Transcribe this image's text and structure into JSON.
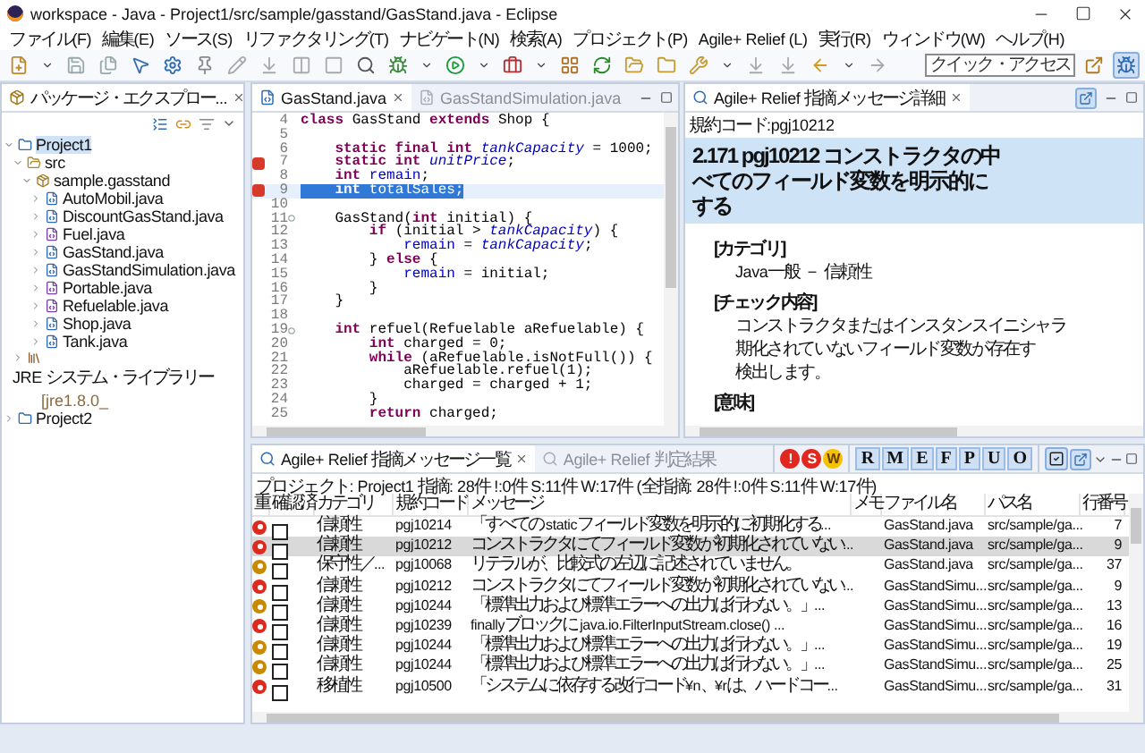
{
  "window": {
    "title": "workspace - Java - Project1/src/sample/gasstand/GasStand.java - Eclipse"
  },
  "menu": [
    "ファイル(F)",
    "編集(E)",
    "ソース(S)",
    "リファクタリング(T)",
    "ナビゲート(N)",
    "検索(A)",
    "プロジェクト(P)",
    "Agile+ Relief (L)",
    "実行(R)",
    "ウィンドウ(W)",
    "ヘルプ(H)"
  ],
  "quick_access": {
    "placeholder": "クイック・アクセス"
  },
  "package_explorer": {
    "tab": "パッケージ・エクスプロー...",
    "tree": [
      {
        "label": "Project1",
        "kind": "project",
        "expanded": true,
        "selected": true,
        "children": [
          {
            "label": "src",
            "kind": "folder",
            "expanded": true,
            "selected": false,
            "children": [
              {
                "label": "sample.gasstand",
                "kind": "package",
                "expanded": true,
                "selected": false,
                "children": [
                  {
                    "label": "AutoMobil.java",
                    "kind": "class",
                    "expanded": false,
                    "selected": false
                  },
                  {
                    "label": "DiscountGasStand.java",
                    "kind": "class",
                    "expanded": false,
                    "selected": false
                  },
                  {
                    "label": "Fuel.java",
                    "kind": "interface",
                    "expanded": false,
                    "selected": false
                  },
                  {
                    "label": "GasStand.java",
                    "kind": "class",
                    "expanded": false,
                    "selected": false
                  },
                  {
                    "label": "GasStandSimulation.java",
                    "kind": "class",
                    "expanded": false,
                    "selected": false
                  },
                  {
                    "label": "Portable.java",
                    "kind": "interface",
                    "expanded": false,
                    "selected": false
                  },
                  {
                    "label": "Refuelable.java",
                    "kind": "interface",
                    "expanded": false,
                    "selected": false
                  },
                  {
                    "label": "Shop.java",
                    "kind": "class",
                    "expanded": false,
                    "selected": false
                  },
                  {
                    "label": "Tank.java",
                    "kind": "class",
                    "expanded": false,
                    "selected": false
                  }
                ]
              }
            ]
          },
          {
            "label": "JRE システム・ライブラリー",
            "decoration": "[jre1.8.0_",
            "kind": "library",
            "expanded": false,
            "selected": false
          }
        ]
      },
      {
        "label": "Project2",
        "kind": "project",
        "expanded": false,
        "selected": false
      }
    ]
  },
  "editor": {
    "tabs": [
      {
        "label": "GasStand.java",
        "selected": true
      },
      {
        "label": "GasStandSimulation.java",
        "selected": false
      }
    ],
    "lines": [
      {
        "number": "4",
        "error": false,
        "fold": false,
        "selected": false,
        "tokens": [
          {
            "kind": "kw",
            "text": "class"
          },
          {
            "kind": "plain",
            "text": " GasStand "
          },
          {
            "kind": "kw",
            "text": "extends"
          },
          {
            "kind": "plain",
            "text": " Shop {"
          }
        ]
      },
      {
        "number": "5",
        "error": false,
        "fold": false,
        "selected": false
      },
      {
        "number": "6",
        "error": false,
        "fold": false,
        "selected": false,
        "tokens": [
          {
            "kind": "kw",
            "text": "    static final int"
          },
          {
            "kind": "static",
            "text": " tankCapacity"
          },
          {
            "kind": "plain",
            "text": " = 1000;"
          }
        ]
      },
      {
        "number": "7",
        "error": true,
        "fold": false,
        "selected": false,
        "tokens": [
          {
            "kind": "kw",
            "text": "    static int"
          },
          {
            "kind": "static",
            "text": " unitPrice"
          },
          {
            "kind": "plain",
            "text": ";"
          }
        ]
      },
      {
        "number": "8",
        "error": false,
        "fold": false,
        "selected": false,
        "tokens": [
          {
            "kind": "kw",
            "text": "    int"
          },
          {
            "kind": "field",
            "text": " remain"
          },
          {
            "kind": "plain",
            "text": ";"
          }
        ]
      },
      {
        "number": "9",
        "error": true,
        "fold": false,
        "selected": true,
        "tokens": [
          {
            "kind": "kw",
            "text": "    int"
          },
          {
            "kind": "field",
            "text": " totalSales"
          },
          {
            "kind": "plain",
            "text": ";"
          }
        ]
      },
      {
        "number": "10",
        "error": false,
        "fold": false,
        "selected": false
      },
      {
        "number": "11",
        "error": false,
        "fold": true,
        "selected": false,
        "tokens": [
          {
            "kind": "plain",
            "text": "    GasStand("
          },
          {
            "kind": "kw",
            "text": "int"
          },
          {
            "kind": "plain",
            "text": " initial) {"
          }
        ]
      },
      {
        "number": "12",
        "error": false,
        "fold": false,
        "selected": false,
        "tokens": [
          {
            "kind": "kw",
            "text": "        if"
          },
          {
            "kind": "plain",
            "text": " (initial > "
          },
          {
            "kind": "static",
            "text": "tankCapacity"
          },
          {
            "kind": "plain",
            "text": ") {"
          }
        ]
      },
      {
        "number": "13",
        "error": false,
        "fold": false,
        "selected": false,
        "tokens": [
          {
            "kind": "field",
            "text": "            remain"
          },
          {
            "kind": "plain",
            "text": " = "
          },
          {
            "kind": "static",
            "text": "tankCapacity"
          },
          {
            "kind": "plain",
            "text": ";"
          }
        ]
      },
      {
        "number": "14",
        "error": false,
        "fold": false,
        "selected": false,
        "tokens": [
          {
            "kind": "plain",
            "text": "        } "
          },
          {
            "kind": "kw",
            "text": "else"
          },
          {
            "kind": "plain",
            "text": " {"
          }
        ]
      },
      {
        "number": "15",
        "error": false,
        "fold": false,
        "selected": false,
        "tokens": [
          {
            "kind": "field",
            "text": "            remain"
          },
          {
            "kind": "plain",
            "text": " = initial;"
          }
        ]
      },
      {
        "number": "16",
        "error": false,
        "fold": false,
        "selected": false,
        "tokens": [
          {
            "kind": "plain",
            "text": "        }"
          }
        ]
      },
      {
        "number": "17",
        "error": false,
        "fold": false,
        "selected": false,
        "tokens": [
          {
            "kind": "plain",
            "text": "    }"
          }
        ]
      },
      {
        "number": "18",
        "error": false,
        "fold": false,
        "selected": false
      },
      {
        "number": "19",
        "error": false,
        "fold": true,
        "selected": false,
        "tokens": [
          {
            "kind": "kw",
            "text": "    int"
          },
          {
            "kind": "plain",
            "text": " refuel(Refuelable aRefuelable) {"
          }
        ]
      },
      {
        "number": "20",
        "error": false,
        "fold": false,
        "selected": false,
        "tokens": [
          {
            "kind": "kw",
            "text": "        int"
          },
          {
            "kind": "plain",
            "text": " charged = 0;"
          }
        ]
      },
      {
        "number": "21",
        "error": false,
        "fold": false,
        "selected": false,
        "tokens": [
          {
            "kind": "kw",
            "text": "        while"
          },
          {
            "kind": "plain",
            "text": " (aRefuelable.isNotFull()) {"
          }
        ]
      },
      {
        "number": "22",
        "error": false,
        "fold": false,
        "selected": false,
        "tokens": [
          {
            "kind": "plain",
            "text": "            aRefuelable.refuel(1);"
          }
        ]
      },
      {
        "number": "23",
        "error": false,
        "fold": false,
        "selected": false,
        "tokens": [
          {
            "kind": "plain",
            "text": "            charged = charged + 1;"
          }
        ]
      },
      {
        "number": "24",
        "error": false,
        "fold": false,
        "selected": false,
        "tokens": [
          {
            "kind": "plain",
            "text": "        }"
          }
        ]
      },
      {
        "number": "25",
        "error": false,
        "fold": false,
        "selected": false,
        "tokens": [
          {
            "kind": "kw",
            "text": "        return"
          },
          {
            "kind": "plain",
            "text": " charged;"
          }
        ]
      }
    ]
  },
  "details": {
    "tab": "Agile+ Relief 指摘メッセージ詳細",
    "code_label": "規約コード:pgj10212",
    "heading": [
      "2.171 pgj10212  コンストラクタの中",
      "べてのフィールド変数を明示的に",
      "する"
    ],
    "sections": [
      {
        "title": "[カテゴリ]",
        "lines": [
          "Java一般 － 信頼性"
        ]
      },
      {
        "title": "[チェック内容]",
        "lines": [
          "コンストラクタまたはインスタンスイニシャラ",
          "期化されていないフィールド変数が存在す",
          "検出します。"
        ]
      },
      {
        "title": "[意味]"
      }
    ]
  },
  "messages": {
    "tabs": [
      {
        "label": "Agile+ Relief 指摘メッセージ一覧",
        "selected": true
      },
      {
        "label": "Agile+ Relief 判定結果",
        "selected": false
      }
    ],
    "severity_filters": [
      {
        "label": "!",
        "kind": "fatal"
      },
      {
        "label": "S",
        "kind": "serious"
      },
      {
        "label": "W",
        "kind": "warning"
      }
    ],
    "category_filters": [
      {
        "label": "R",
        "selected": true
      },
      {
        "label": "M",
        "selected": true
      },
      {
        "label": "E",
        "selected": true
      },
      {
        "label": "F",
        "selected": true
      },
      {
        "label": "P",
        "selected": true
      },
      {
        "label": "U",
        "selected": true
      },
      {
        "label": "O",
        "selected": true
      }
    ],
    "summary": "プロジェクト: Project1  指摘: 28件 !:0件 S:11件 W:17件 (全指摘: 28件 !:0件 S:11件 W:17件)",
    "columns": [
      "重",
      "確認済",
      "カテゴリ",
      "規約コード",
      "メッセージ",
      "メモ",
      "ファイル名",
      "パス名",
      "行番号"
    ],
    "rows": [
      {
        "kind": "serious",
        "checked": false,
        "selected": false,
        "category": "信頼性",
        "code": "pgj10214",
        "message": "「すべての staticフィールド変数を明示的に初期化する...",
        "file": "GasStand.java",
        "path": "src/sample/ga...",
        "line": "7"
      },
      {
        "kind": "serious",
        "checked": false,
        "selected": true,
        "category": "信頼性",
        "code": "pgj10212",
        "message": "コンストラクタにてフィールド変数が初期化されていない...",
        "file": "GasStand.java",
        "path": "src/sample/ga...",
        "line": "9"
      },
      {
        "kind": "warning",
        "checked": false,
        "selected": false,
        "category": "保守性／...",
        "code": "pgj10068",
        "message": "リテラルが、比較式の左辺に記述されていません。",
        "file": "GasStand.java",
        "path": "src/sample/ga...",
        "line": "37"
      },
      {
        "kind": "serious",
        "checked": false,
        "selected": false,
        "category": "信頼性",
        "code": "pgj10212",
        "message": "コンストラクタにてフィールド変数が初期化されていない...",
        "file": "GasStandSimu...",
        "path": "src/sample/ga...",
        "line": "9"
      },
      {
        "kind": "warning",
        "checked": false,
        "selected": false,
        "category": "信頼性",
        "code": "pgj10244",
        "message": "「標準出力および標準エラーへの出力は行わない。」...",
        "file": "GasStandSimu...",
        "path": "src/sample/ga...",
        "line": "13"
      },
      {
        "kind": "serious",
        "checked": false,
        "selected": false,
        "category": "信頼性",
        "code": "pgj10239",
        "message": "finallyブロックに java.io.FilterInputStream.close() ...",
        "file": "GasStandSimu...",
        "path": "src/sample/ga...",
        "line": "16"
      },
      {
        "kind": "warning",
        "checked": false,
        "selected": false,
        "category": "信頼性",
        "code": "pgj10244",
        "message": "「標準出力および標準エラーへの出力は行わない。」...",
        "file": "GasStandSimu...",
        "path": "src/sample/ga...",
        "line": "19"
      },
      {
        "kind": "warning",
        "checked": false,
        "selected": false,
        "category": "信頼性",
        "code": "pgj10244",
        "message": "「標準出力および標準エラーへの出力は行わない。」...",
        "file": "GasStandSimu...",
        "path": "src/sample/ga...",
        "line": "25"
      },
      {
        "kind": "serious",
        "checked": false,
        "selected": false,
        "category": "移植性",
        "code": "pgj10500",
        "message": "「システムに依存する改行コード¥n、¥rは、ハードコー...",
        "file": "GasStandSimu...",
        "path": "src/sample/ga...",
        "line": "31"
      }
    ]
  }
}
